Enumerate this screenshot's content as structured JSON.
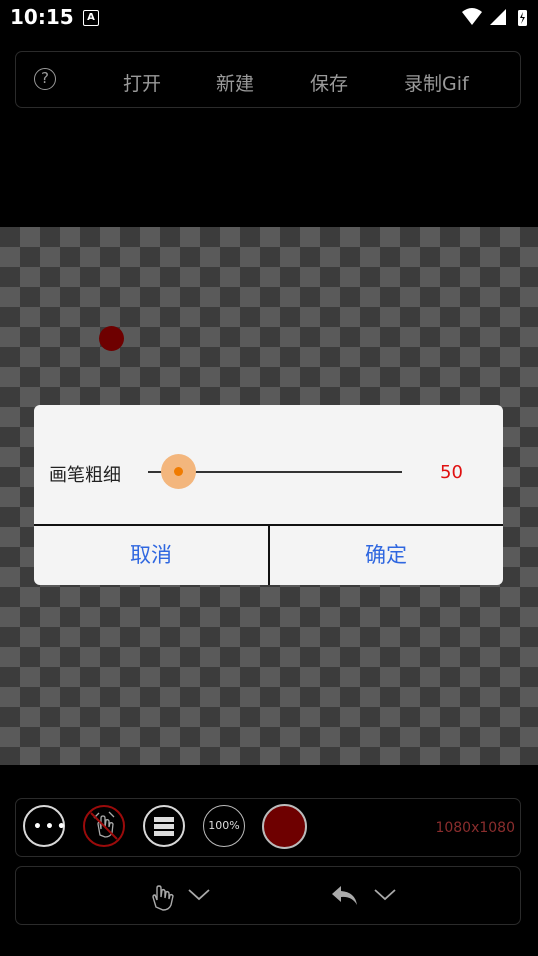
{
  "status_bar": {
    "time": "10:15",
    "notification_letter": "A"
  },
  "top_toolbar": {
    "help": "?",
    "open": "打开",
    "new": "新建",
    "save": "保存",
    "record_gif": "录制Gif"
  },
  "dialog": {
    "label": "画笔粗细",
    "value": "50",
    "slider_fraction": 0.12,
    "cancel": "取消",
    "confirm": "确定"
  },
  "tool_bar": {
    "zoom": "100%",
    "canvas_size": "1080x1080",
    "brush_color": "#6e0000"
  },
  "colors": {
    "accent_blue": "#2f67e0",
    "value_red": "#e01010",
    "slider_orange": "#f07b00"
  },
  "icons": [
    "help-icon",
    "more-icon",
    "gesture-icon",
    "layers-icon",
    "hand-icon",
    "undo-icon",
    "chevron-down-icon"
  ]
}
